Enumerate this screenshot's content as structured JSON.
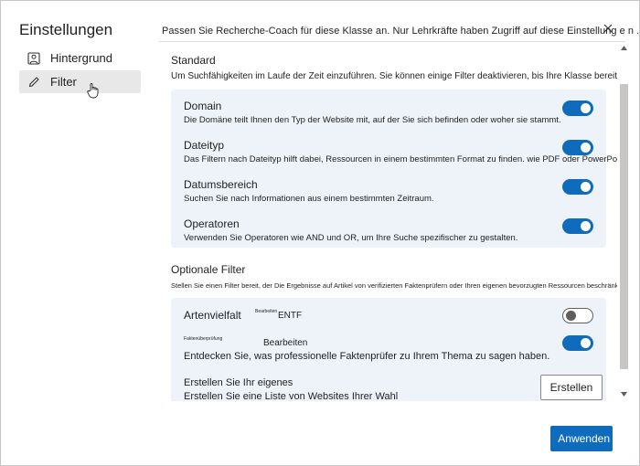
{
  "sidebar": {
    "title": "Einstellungen",
    "items": [
      {
        "label": "Hintergrund",
        "icon": "image-icon",
        "active": false
      },
      {
        "label": "Filter",
        "icon": "pencil-icon",
        "active": true
      }
    ]
  },
  "header": {
    "intro": "Passen Sie Recherche-Coach für diese Klasse an. Nur Lehrkräfte haben Zugriff auf diese Einstellung e n ."
  },
  "standard": {
    "title": "Standard",
    "description": "Um Suchfähigkeiten im Laufe der Zeit einzuführen. Sie können einige Filter deaktivieren, bis Ihre Klasse bereit ist.",
    "items": [
      {
        "title": "Domain",
        "description": "Die Domäne teilt Ihnen den Typ der Website mit, auf der Sie sich befinden oder woher sie stammt.",
        "on": true
      },
      {
        "title": "Dateityp",
        "description": "Das Filtern nach Dateityp hilft dabei, Ressourcen in einem bestimmten Format zu finden. wie PDF oder PowerPoint.",
        "on": true
      },
      {
        "title": "Datumsbereich",
        "description": "Suchen Sie nach Informationen aus einem bestimmten Zeitraum.",
        "on": true
      },
      {
        "title": "Operatoren",
        "description": "Verwenden Sie Operatoren wie AND und OR, um Ihre Suche spezifischer zu gestalten.",
        "on": true
      }
    ]
  },
  "optional": {
    "title": "Optionale Filter",
    "description": "Stellen Sie einen Filter bereit, der Die Ergebnisse auf Artikel von verifizierten Faktenprüfern oder Ihren eigenen bevorzugten Ressourcen beschränkt.",
    "artenvielfalt": {
      "title": "Artenvielfalt",
      "tiny_label": "Bearbeiten",
      "action": "ENTF",
      "on": false
    },
    "fakten": {
      "tiny_label": "Faktenüberprüfung",
      "action": "Bearbeiten",
      "description": "Entdecken Sie, was professionelle Faktenprüfer zu Ihrem Thema zu sagen haben.",
      "on": true
    },
    "create": {
      "title": "Erstellen Sie Ihr eigenes",
      "description": "Erstellen Sie eine Liste von Websites Ihrer Wahl",
      "button": "Erstellen"
    }
  },
  "footer": {
    "apply": "Anwenden"
  },
  "colors": {
    "accent": "#0f6cbd",
    "card": "#eef3fa"
  }
}
